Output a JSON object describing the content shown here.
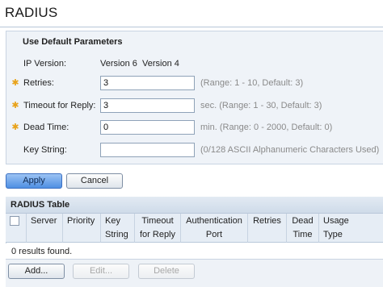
{
  "page": {
    "title": "RADIUS"
  },
  "params": {
    "heading": "Use Default Parameters",
    "ip_version": {
      "label": "IP Version:",
      "option_1": "Version 6",
      "option_2": "Version 4"
    },
    "retries": {
      "label": "Retries:",
      "value": "3",
      "hint": "(Range: 1 - 10, Default: 3)"
    },
    "timeout": {
      "label": "Timeout for Reply:",
      "value": "3",
      "hint": "sec. (Range: 1 - 30, Default: 3)"
    },
    "dead_time": {
      "label": "Dead Time:",
      "value": "0",
      "hint": "min. (Range: 0 - 2000, Default: 0)"
    },
    "key_string": {
      "label": "Key String:",
      "value": "",
      "hint": "(0/128 ASCII Alphanumeric Characters Used)"
    },
    "required_icon": "asterisk-icon",
    "required_color": "#e8a21a"
  },
  "actions": {
    "apply": "Apply",
    "cancel": "Cancel"
  },
  "table": {
    "caption": "RADIUS Table",
    "columns": [
      {
        "line1": "Server",
        "line2": ""
      },
      {
        "line1": "Priority",
        "line2": ""
      },
      {
        "line1": "Key",
        "line2": "String"
      },
      {
        "line1": "Timeout",
        "line2": "for Reply"
      },
      {
        "line1": "Authentication",
        "line2": "Port"
      },
      {
        "line1": "Retries",
        "line2": ""
      },
      {
        "line1": "Dead",
        "line2": "Time"
      },
      {
        "line1": "Usage",
        "line2": "Type"
      }
    ],
    "results": "0 results found.",
    "buttons": {
      "add": "Add...",
      "edit": "Edit...",
      "delete": "Delete"
    }
  },
  "colors": {
    "accent_button": "#4f8fe3",
    "panel_background": "#eff3f8",
    "hint_text": "#8a8a8a"
  }
}
